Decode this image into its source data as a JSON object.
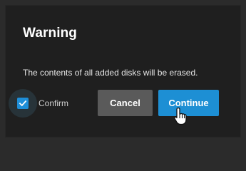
{
  "dialog": {
    "title": "Warning",
    "message": "The contents of all added disks will be erased.",
    "confirm": {
      "label": "Confirm",
      "checked": true
    },
    "buttons": {
      "cancel_label": "Cancel",
      "continue_label": "Continue"
    }
  },
  "colors": {
    "page_background": "#2b2b2b",
    "dialog_background": "#1f1f1f",
    "accent": "#1d8fd4",
    "cancel_button": "#5a5a5a"
  },
  "cursor": {
    "icon": "hand-pointer-icon"
  }
}
